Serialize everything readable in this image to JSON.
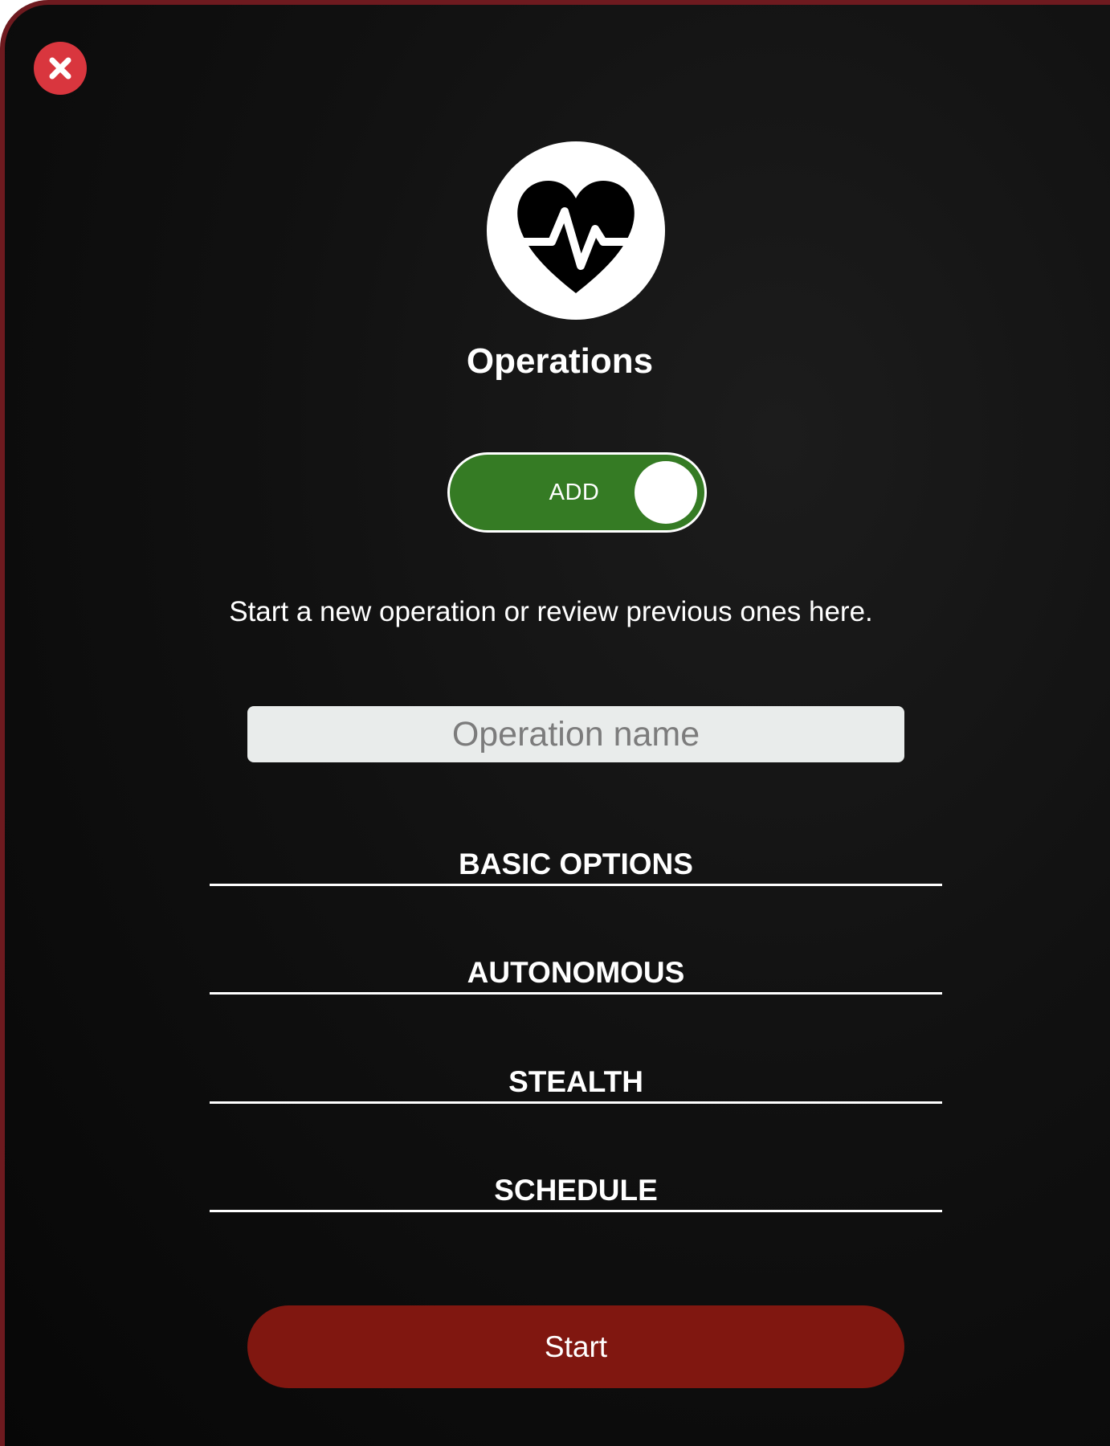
{
  "header": {
    "close_icon": "close-icon",
    "logo_icon": "heart-pulse-icon",
    "title": "Operations"
  },
  "mode_toggle": {
    "label": "ADD",
    "on": true
  },
  "description": "Start a new operation or review previous ones here.",
  "name_field": {
    "placeholder": "Operation name",
    "value": ""
  },
  "sections": [
    {
      "label": "BASIC OPTIONS"
    },
    {
      "label": "AUTONOMOUS"
    },
    {
      "label": "STEALTH"
    },
    {
      "label": "SCHEDULE"
    }
  ],
  "start_button": {
    "label": "Start"
  },
  "colors": {
    "close": "#d9363e",
    "toggle_on": "#357b24",
    "start": "#801710",
    "frame": "#6e1a1f"
  }
}
